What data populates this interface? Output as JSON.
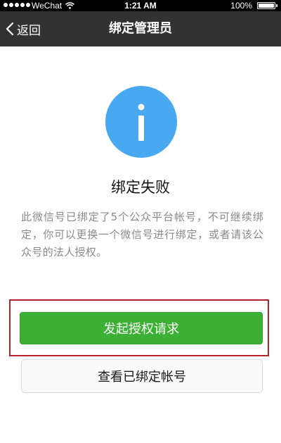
{
  "status_bar": {
    "carrier": "WeChat",
    "time": "1:21 AM",
    "battery": "100%"
  },
  "nav": {
    "back_label": "返回",
    "title": "绑定管理员"
  },
  "result": {
    "icon": "info-icon",
    "icon_color": "#48a8f0",
    "title": "绑定失败",
    "description": "此微信号已绑定了5个公众平台帐号，不可继续绑定，你可以更换一个微信号进行绑定，或者请该公众号的法人授权。"
  },
  "actions": {
    "primary_label": "发起授权请求",
    "primary_color": "#3cb035",
    "secondary_label": "查看已绑定帐号",
    "highlight_color": "#b0242c"
  }
}
